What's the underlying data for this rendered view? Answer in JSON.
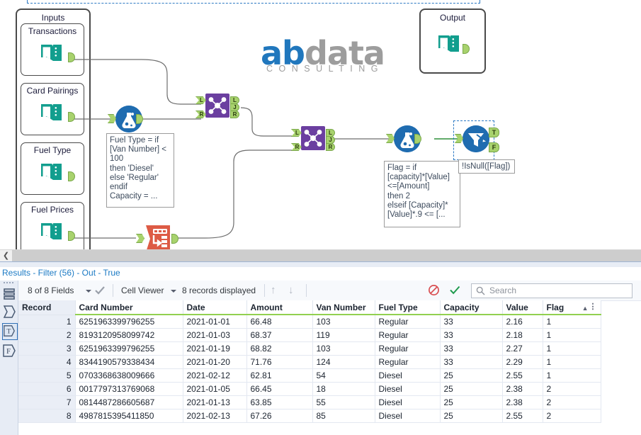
{
  "canvas": {
    "inputs_container_title": "Inputs",
    "output_container_title": "Output",
    "inputs": [
      {
        "label": "Transactions"
      },
      {
        "label": "Card Pairings"
      },
      {
        "label": "Fuel Type"
      },
      {
        "label": "Fuel Prices"
      }
    ],
    "logo": {
      "part1": "ab",
      "part2": "data",
      "tagline": "CONSULTING"
    },
    "annotations": {
      "formula1": "Fuel Type = if\n[Van Number] <\n100\nthen 'Diesel'\nelse 'Regular'\nendif\nCapacity = ...",
      "formula2": "Flag = if\n[capacity]*[Value]\n<=[Amount]\nthen 2\nelseif [Capacity]*\n[Value]*.9 <= [...",
      "filter": "!IsNull([Flag])"
    },
    "join_anchors": {
      "left": "L",
      "right": "R",
      "join": "J"
    },
    "filter_anchors": {
      "true": "T",
      "false": "F"
    }
  },
  "results": {
    "title": "Results - Filter (56) - Out - True",
    "toolbar": {
      "fields": "8 of 8 Fields",
      "viewer": "Cell Viewer",
      "records": "8 records displayed",
      "search_placeholder": "Search",
      "up_arrow": "↑",
      "down_arrow": "↓",
      "block_icon": "no-entry-icon",
      "check_icon": "checkmark-icon"
    },
    "rail": {
      "items": [
        {
          "name": "data-view-icon",
          "glyph": "≡"
        },
        {
          "name": "sigma-anchor-icon",
          "glyph": "Σ"
        },
        {
          "name": "true-anchor-icon",
          "glyph": "T",
          "selected": true
        },
        {
          "name": "false-anchor-icon",
          "glyph": "F",
          "selected": false
        }
      ]
    },
    "columns": [
      "Record",
      "Card Number",
      "Date",
      "Amount",
      "Van Number",
      "Fuel Type",
      "Capacity",
      "Value",
      "Flag"
    ],
    "sorted_column": "Flag",
    "sort_direction": "asc",
    "rows": [
      {
        "record": "1",
        "card": "6251963399796255",
        "date": "2021-01-01",
        "amount": "66.48",
        "van": "103",
        "fuel": "Regular",
        "capacity": "33",
        "value": "2.16",
        "flag": "1"
      },
      {
        "record": "2",
        "card": "8193120958099742",
        "date": "2021-01-03",
        "amount": "68.37",
        "van": "119",
        "fuel": "Regular",
        "capacity": "33",
        "value": "2.18",
        "flag": "1"
      },
      {
        "record": "3",
        "card": "6251963399796255",
        "date": "2021-01-19",
        "amount": "68.82",
        "van": "103",
        "fuel": "Regular",
        "capacity": "33",
        "value": "2.27",
        "flag": "1"
      },
      {
        "record": "4",
        "card": "8344190579338434",
        "date": "2021-01-20",
        "amount": "71.76",
        "van": "124",
        "fuel": "Regular",
        "capacity": "33",
        "value": "2.29",
        "flag": "1"
      },
      {
        "record": "5",
        "card": "0703368638009666",
        "date": "2021-02-12",
        "amount": "62.81",
        "van": "54",
        "fuel": "Diesel",
        "capacity": "25",
        "value": "2.55",
        "flag": "1"
      },
      {
        "record": "6",
        "card": "0017797313769068",
        "date": "2021-01-05",
        "amount": "66.45",
        "van": "18",
        "fuel": "Diesel",
        "capacity": "25",
        "value": "2.38",
        "flag": "2"
      },
      {
        "record": "7",
        "card": "0814487286605687",
        "date": "2021-01-13",
        "amount": "63.85",
        "van": "55",
        "fuel": "Diesel",
        "capacity": "25",
        "value": "2.38",
        "flag": "2"
      },
      {
        "record": "8",
        "card": "4987815395411850",
        "date": "2021-02-13",
        "amount": "67.26",
        "van": "85",
        "fuel": "Diesel",
        "capacity": "25",
        "value": "2.55",
        "flag": "2"
      }
    ]
  },
  "colors": {
    "input_teal": "#129e8e",
    "tool_blue": "#1f6cb0",
    "join_purple": "#6b3fa0",
    "transpose_red": "#dd5b45",
    "anchor_green": "#a8d26d",
    "header_underline": "#92d050",
    "link_blue": "#1b7ac4",
    "selection_blue": "#2d7ac4"
  }
}
